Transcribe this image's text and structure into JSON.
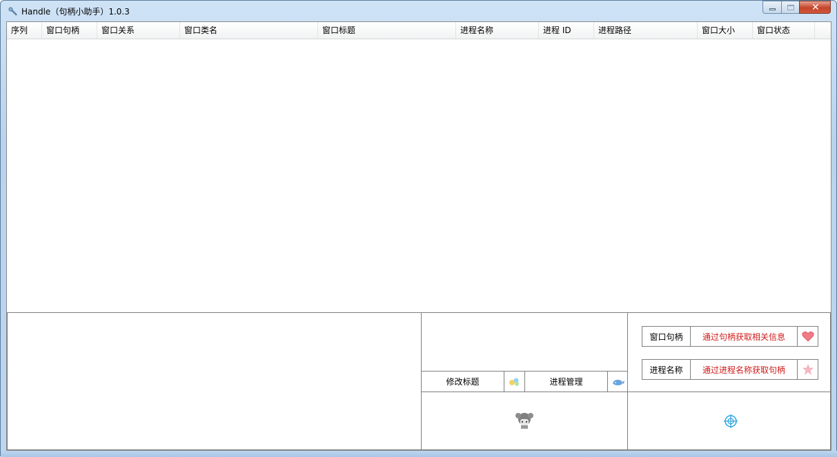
{
  "window": {
    "title": "Handle（句柄小助手）1.0.3",
    "controls": [
      "minimize-icon",
      "maximize-icon",
      "close-icon"
    ]
  },
  "list": {
    "columns": [
      "序列",
      "窗口句柄",
      "窗口关系",
      "窗口类名",
      "窗口标题",
      "进程名称",
      "进程 ID",
      "进程路径",
      "窗口大小",
      "窗口状态"
    ],
    "rows": []
  },
  "actions": {
    "modify_title": "修改标题",
    "process_manager": "进程管理"
  },
  "handle_lookup": {
    "label": "窗口句柄",
    "button": "通过句柄获取相关信息"
  },
  "process_lookup": {
    "label": "进程名称",
    "button": "通过进程名称获取句柄"
  },
  "icons": [
    "sparkle-icon",
    "whale-icon",
    "heart-icon",
    "star-icon",
    "character-icon",
    "crosshair-icon",
    "wrench-icon"
  ],
  "colors": {
    "accent_red": "#d11a1a",
    "title_gradient": "#bcd6f0"
  }
}
